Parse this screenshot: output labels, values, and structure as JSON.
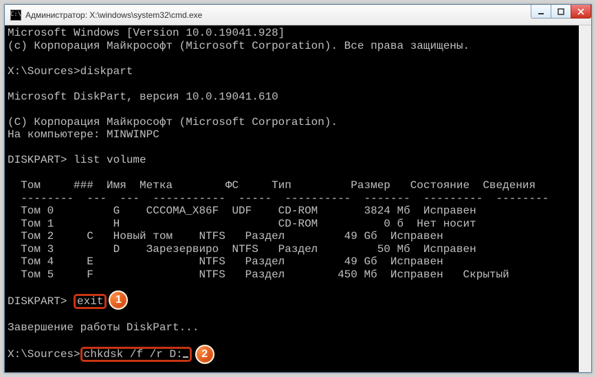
{
  "window": {
    "title": "Администратор: X:\\windows\\system32\\cmd.exe",
    "icon_label": "C:\\"
  },
  "term": {
    "l1": "Microsoft Windows [Version 10.0.19041.928]",
    "l2": "(c) Корпорация Майкрософт (Microsoft Corporation). Все права защищены.",
    "l3": "",
    "p1_prompt": "X:\\Sources>",
    "p1_cmd": "diskpart",
    "l5": "",
    "l6": "Microsoft DiskPart, версия 10.0.19041.610",
    "l7": "",
    "l8": "(C) Корпорация Майкрософт (Microsoft Corporation).",
    "l9": "На компьютере: MINWINPC",
    "l10": "",
    "p2_prompt": "DISKPART> ",
    "p2_cmd": "list volume",
    "l12": "",
    "th": "  Том     ###  Имя  Метка        ФС     Тип         Размер   Состояние  Сведения",
    "tr": "  --------  ---  ---  -----------  -----  ----------  -------  ---------  --------",
    "r0": "  Том 0         G    CCCOMA_X86F  UDF    CD-ROM       3824 Мб  Исправен",
    "r1": "  Том 1         H                        CD-ROM          0 б  Нет носит",
    "r2": "  Том 2     C   Новый том    NTFS   Раздел         49 Gб  Исправен",
    "r3": "  Том 3         D    Зарезервиро  NTFS   Раздел         50 Mб  Исправен",
    "r4": "  Том 4     E                NTFS   Раздел         49 Gб  Исправен",
    "r5": "  Том 5     F                NTFS   Раздел        450 Mб  Исправен   Скрытый",
    "l20": "",
    "p3_prompt": "DISKPART> ",
    "p3_cmd": "exit",
    "l22": "",
    "l23": "Завершение работы DiskPart...",
    "l24": "",
    "p4_prompt": "X:\\Sources>",
    "p4_cmd": "chkdsk /f /r D:"
  },
  "annotations": {
    "badge1": "1",
    "badge2": "2",
    "hl1_target": "exit",
    "hl2_target": "chkdsk /f /r D:"
  }
}
